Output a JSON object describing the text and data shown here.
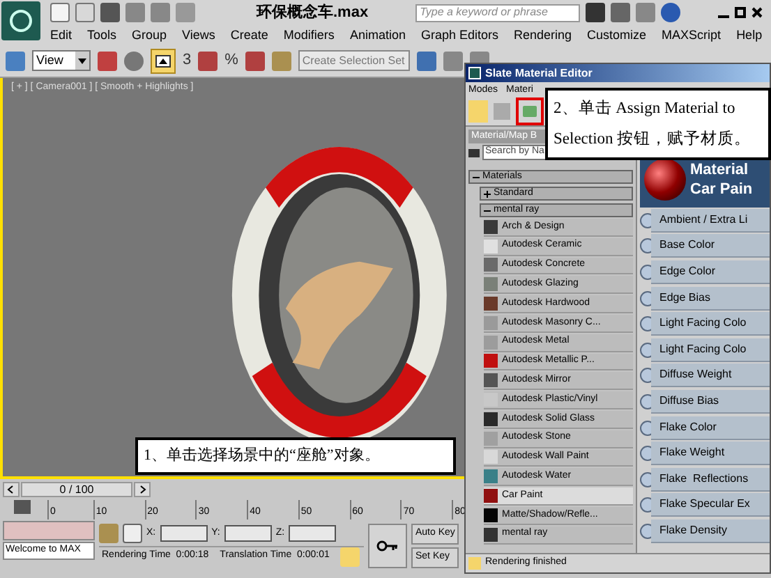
{
  "title_bar": {
    "title": "环保概念车.max",
    "search_placeholder": "Type a keyword or phrase"
  },
  "menu": [
    "Edit",
    "Tools",
    "Group",
    "Views",
    "Create",
    "Modifiers",
    "Animation",
    "Graph Editors",
    "Rendering",
    "Customize",
    "MAXScript",
    "Help"
  ],
  "toolbar": {
    "view_select": "View",
    "snap_angle": "3",
    "snap_percent": "%",
    "selection_set_placeholder": "Create Selection Set"
  },
  "viewport": {
    "label": "[ + ] [ Camera001 ] [ Smooth + Highlights ]"
  },
  "callouts": [
    {
      "text": "1、单击选择场景中的“座舱”对象。"
    },
    {
      "text": "2、单击 Assign Material to Selection 按钮，赋予材质。"
    }
  ],
  "material_editor": {
    "title": "Slate Material Editor",
    "menu": [
      "Modes",
      "Materi"
    ],
    "browser_title": "Material/Map B",
    "search_placeholder": "Search by Na",
    "tree": [
      {
        "label": "Materials",
        "expanded": true,
        "children": [
          {
            "label": "Standard",
            "expanded": false
          },
          {
            "label": "mental ray",
            "expanded": true,
            "items": [
              {
                "label": "Arch & Design",
                "selected": false,
                "color": "#3a3a3a"
              },
              {
                "label": "Autodesk Ceramic",
                "selected": false,
                "color": "#e0e0e0"
              },
              {
                "label": "Autodesk Concrete",
                "selected": false,
                "color": "#6a6a6a"
              },
              {
                "label": "Autodesk Glazing",
                "selected": false,
                "color": "#7a8078"
              },
              {
                "label": "Autodesk Hardwood",
                "selected": false,
                "color": "#6a3a2a"
              },
              {
                "label": "Autodesk Masonry C...",
                "selected": false,
                "color": "#9a9a9a"
              },
              {
                "label": "Autodesk Metal",
                "selected": false,
                "color": "#9c9c9c"
              },
              {
                "label": "Autodesk Metallic P...",
                "selected": false,
                "color": "#c01010"
              },
              {
                "label": "Autodesk Mirror",
                "selected": false,
                "color": "#555555"
              },
              {
                "label": "Autodesk Plastic/Vinyl",
                "selected": false,
                "color": "#c8c8c8"
              },
              {
                "label": "Autodesk Solid Glass",
                "selected": false,
                "color": "#2a2a2a"
              },
              {
                "label": "Autodesk Stone",
                "selected": false,
                "color": "#a0a0a0"
              },
              {
                "label": "Autodesk Wall Paint",
                "selected": false,
                "color": "#d8d8d8"
              },
              {
                "label": "Autodesk Water",
                "selected": false,
                "color": "#3a8088"
              },
              {
                "label": "Car Paint",
                "selected": true,
                "color": "#901010"
              },
              {
                "label": "Matte/Shadow/Refle...",
                "selected": false,
                "color": "#050505"
              },
              {
                "label": "mental ray",
                "selected": false,
                "color": "#333333"
              }
            ]
          }
        ]
      }
    ],
    "node": {
      "title_lines": [
        "Material",
        "Car Pain"
      ],
      "slots": [
        "Ambient / Extra Li",
        "Base Color",
        "Edge Color",
        "Edge Bias",
        "Light Facing Colo",
        "Light Facing Colo",
        "Diffuse Weight",
        "Diffuse Bias",
        "Flake Color",
        "Flake Weight",
        "Flake  Reflections",
        "Flake Specular Ex",
        "Flake Density"
      ]
    },
    "status": "Rendering finished"
  },
  "timeline": {
    "frame": "0 / 100",
    "ticks": [
      "0",
      "10",
      "20",
      "30",
      "40",
      "50",
      "60",
      "70",
      "80"
    ]
  },
  "status_bar": {
    "prompt": "Welcome to MAX",
    "x_label": "X:",
    "y_label": "Y:",
    "z_label": "Z:",
    "rendering_time": "Rendering Time  0:00:18",
    "translation_time": "Translation Time  0:00:01",
    "auto_key": "Auto Key",
    "set_key": "Set Key"
  }
}
